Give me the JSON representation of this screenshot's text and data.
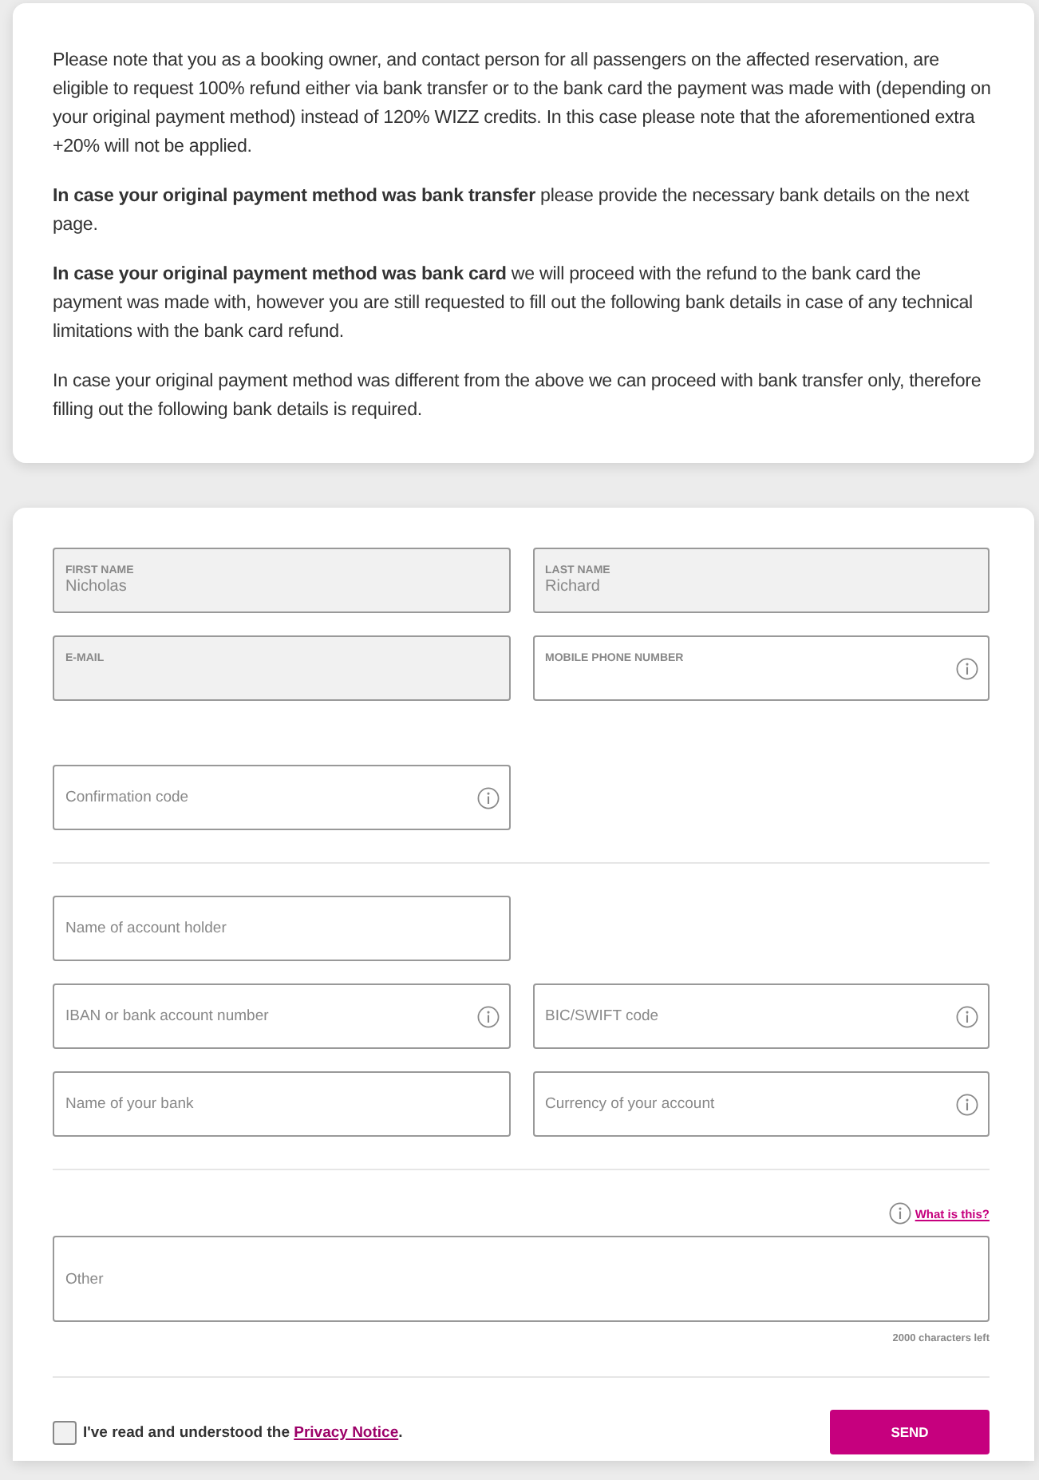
{
  "notice": {
    "paragraphs": [
      "Please note that you as a booking owner, and contact person for all passengers on the affected reservation, are eligible to request 100% refund either via bank transfer or to the bank card the payment was made with (depending on your original payment method) instead of 120% WIZZ credits. In this case please note that the aforementioned extra +20% will not be applied.",
      "**In case your original payment method was bank transfer** please provide the necessary bank details on the next page.",
      "**In case your original payment method was bank card** we will proceed with the refund to the bank card the payment was made with, however you are still requested to fill out the following bank details in case of any technical limitations with the bank card refund.",
      "In case your original payment method was different from the above we can proceed with bank transfer only, therefore filling out the following bank details is required."
    ]
  },
  "form": {
    "sections": [
      {
        "divider_after": false,
        "rows": [
          [
            {
              "kind": "labeled",
              "label": "FIRST NAME",
              "value": "Nicholas",
              "disabled": true,
              "info": false
            },
            {
              "kind": "labeled",
              "label": "LAST NAME",
              "value": "Richard",
              "disabled": true,
              "info": false
            }
          ],
          [
            {
              "kind": "labeled",
              "label": "E-MAIL",
              "disabled": true,
              "info": false
            },
            {
              "kind": "labeled",
              "label": "MOBILE PHONE NUMBER",
              "disabled": false,
              "info": true
            }
          ]
        ]
      },
      {
        "divider_after": true,
        "rows": [
          [
            {
              "kind": "plain",
              "placeholder": "Confirmation code",
              "disabled": false,
              "info": true
            }
          ]
        ]
      },
      {
        "divider_after": true,
        "rows": [
          [
            {
              "kind": "plain",
              "placeholder": "Name of account holder",
              "disabled": false,
              "info": false
            }
          ],
          [
            {
              "kind": "plain",
              "placeholder": "IBAN or bank account number",
              "disabled": false,
              "info": true
            },
            {
              "kind": "plain",
              "placeholder": "BIC/SWIFT code",
              "disabled": false,
              "info": true
            }
          ],
          [
            {
              "kind": "plain",
              "placeholder": "Name of your bank",
              "disabled": false,
              "info": false
            },
            {
              "kind": "plain",
              "placeholder": "Currency of your account",
              "disabled": false,
              "info": true
            }
          ]
        ]
      }
    ],
    "other": {
      "help_link": "What is this?",
      "placeholder": "Other",
      "counter": "2000 characters left"
    },
    "consent": {
      "checked": false,
      "text": "I've read and understood the ",
      "link": "Privacy Notice",
      "after": "."
    },
    "send_button": "SEND"
  }
}
